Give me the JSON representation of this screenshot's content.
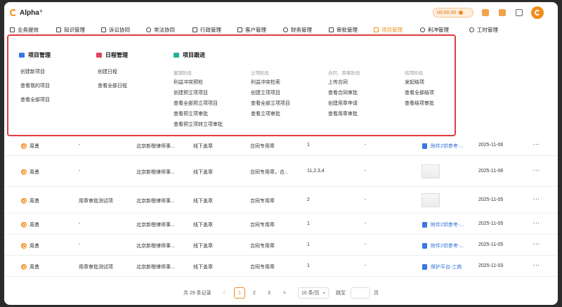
{
  "app": {
    "title": "Alpha⁺",
    "timer": "00:00:00"
  },
  "nav": {
    "items": [
      {
        "label": "业务提效"
      },
      {
        "label": "知识管理"
      },
      {
        "label": "诉讼协同"
      },
      {
        "label": "常法协同"
      },
      {
        "label": "行政管理"
      },
      {
        "label": "客户管理"
      },
      {
        "label": "财务管理"
      },
      {
        "label": "审批管理"
      },
      {
        "label": "项目管理"
      },
      {
        "label": "利冲管理"
      },
      {
        "label": "工时管理"
      }
    ],
    "active_index": 8
  },
  "mega": {
    "project": {
      "title": "项目管理",
      "items": [
        "创建新项目",
        "查看我的项目",
        "查看全部项目"
      ]
    },
    "schedule": {
      "title": "日程管理",
      "items": [
        "创建日程",
        "查看全部日程"
      ]
    },
    "tracking": {
      "title": "项目跟进",
      "stages": [
        {
          "label": "案源阶段",
          "items": [
            "利益冲突预检",
            "创建预立项项目",
            "查看全部预立项项目",
            "查看预立项审批",
            "查看预立项转立项审批"
          ]
        },
        {
          "label": "立项阶段",
          "items": [
            "利益冲突检索",
            "创建立项项目",
            "查看全部立项项目",
            "查看立项审批"
          ]
        },
        {
          "label": "合同、用章阶段",
          "items": [
            "上传合同",
            "查看合同审批",
            "创建用章申请",
            "查看用章审批"
          ]
        },
        {
          "label": "结项阶段",
          "items": [
            "发起结项",
            "查看全部结项",
            "查看结项审批"
          ]
        }
      ]
    }
  },
  "table": {
    "rows": [
      {
        "user": "周勇",
        "reason": "-",
        "firm": "北京新橙律师事...",
        "method": "线下盖章",
        "seal": "合同专用章",
        "count": "1",
        "remark": "-",
        "attachment": "附件2供参考-...",
        "has_thumb": false,
        "date": "2025-11-06"
      },
      {
        "user": "周勇",
        "reason": "-",
        "firm": "北京新橙律师事...",
        "method": "线下盖章",
        "seal": "合同专用章，合...",
        "count": "11,2,3,4",
        "remark": "-",
        "attachment": "",
        "has_thumb": true,
        "date": "2025-11-06"
      },
      {
        "user": "周勇",
        "reason": "用章审批测试项",
        "firm": "北京新橙律师事...",
        "method": "线下盖章",
        "seal": "合同专用章",
        "count": "2",
        "remark": "-",
        "attachment": "",
        "has_thumb": true,
        "date": "2025-11-05"
      },
      {
        "user": "周勇",
        "reason": "-",
        "firm": "北京新橙律师事...",
        "method": "线下盖章",
        "seal": "合同专用章",
        "count": "1",
        "remark": "-",
        "attachment": "附件2供参考-...",
        "has_thumb": false,
        "date": "2025-11-05"
      },
      {
        "user": "周勇",
        "reason": "-",
        "firm": "北京新橙律师事...",
        "method": "线下盖章",
        "seal": "合同专用章",
        "count": "1",
        "remark": "-",
        "attachment": "附件2供参考-...",
        "has_thumb": false,
        "date": "2025-11-05"
      },
      {
        "user": "周勇",
        "reason": "用章审批测试项",
        "firm": "北京新橙律师事...",
        "method": "线下盖章",
        "seal": "合同专用章",
        "count": "1",
        "remark": "-",
        "attachment": "保护平台-工商",
        "has_thumb": false,
        "date": "2025-11-03"
      }
    ],
    "more_label": "···"
  },
  "pager": {
    "total": "共 29 条记录",
    "prev": "<",
    "pages": [
      "1",
      "2",
      "3"
    ],
    "current": "1",
    "next": ">",
    "page_size": "10 条/页",
    "goto_label": "跳至",
    "goto_suffix": "页"
  },
  "colors": {
    "accent": "#f28c1a",
    "highlight_border": "#e03c3c",
    "link": "#2f6fd6"
  }
}
